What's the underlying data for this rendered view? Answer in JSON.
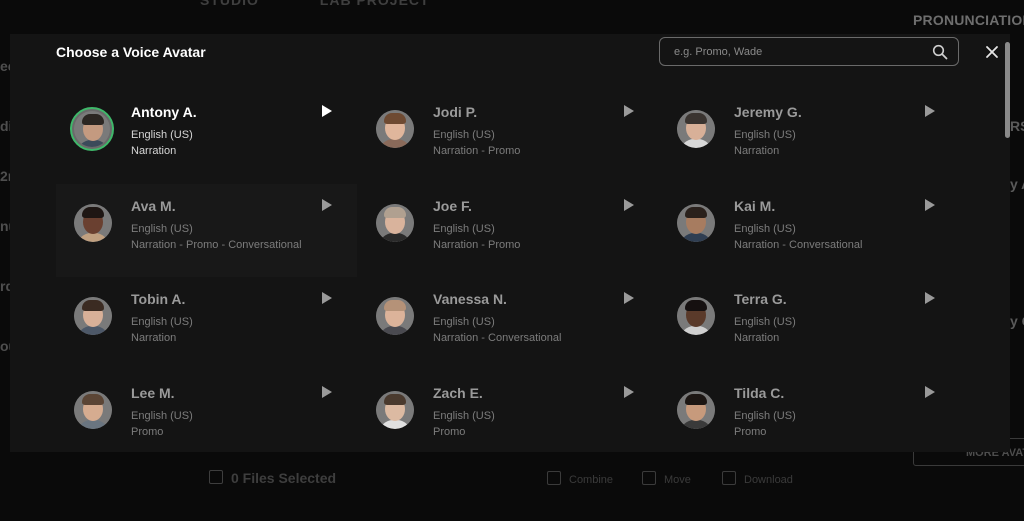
{
  "background": {
    "tabs": [
      "STUDIO",
      "LAB PROJECT"
    ],
    "pronunciation": "PRONUNCIATION",
    "more_button": "MORE AVATARS",
    "files_selected": "0 Files Selected",
    "actions": [
      "Combine",
      "Move",
      "Download"
    ]
  },
  "modal": {
    "title": "Choose a Voice Avatar",
    "search": {
      "placeholder": "e.g. Promo, Wade",
      "value": ""
    },
    "accent_color": "#3fb86a"
  },
  "avatars": [
    {
      "name": "Antony A.",
      "language": "English (US)",
      "tags": "Narration"
    },
    {
      "name": "Jodi P.",
      "language": "English (US)",
      "tags": "Narration - Promo"
    },
    {
      "name": "Jeremy G.",
      "language": "English (US)",
      "tags": "Narration"
    },
    {
      "name": "Ava M.",
      "language": "English (US)",
      "tags": "Narration - Promo - Conversational"
    },
    {
      "name": "Joe F.",
      "language": "English (US)",
      "tags": "Narration - Promo"
    },
    {
      "name": "Kai M.",
      "language": "English (US)",
      "tags": "Narration - Conversational"
    },
    {
      "name": "Tobin A.",
      "language": "English (US)",
      "tags": "Narration"
    },
    {
      "name": "Vanessa N.",
      "language": "English (US)",
      "tags": "Narration - Conversational"
    },
    {
      "name": "Terra G.",
      "language": "English (US)",
      "tags": "Narration"
    },
    {
      "name": "Lee M.",
      "language": "English (US)",
      "tags": "Promo"
    },
    {
      "name": "Zach E.",
      "language": "English (US)",
      "tags": "Promo"
    },
    {
      "name": "Tilda C.",
      "language": "English (US)",
      "tags": "Promo"
    }
  ]
}
